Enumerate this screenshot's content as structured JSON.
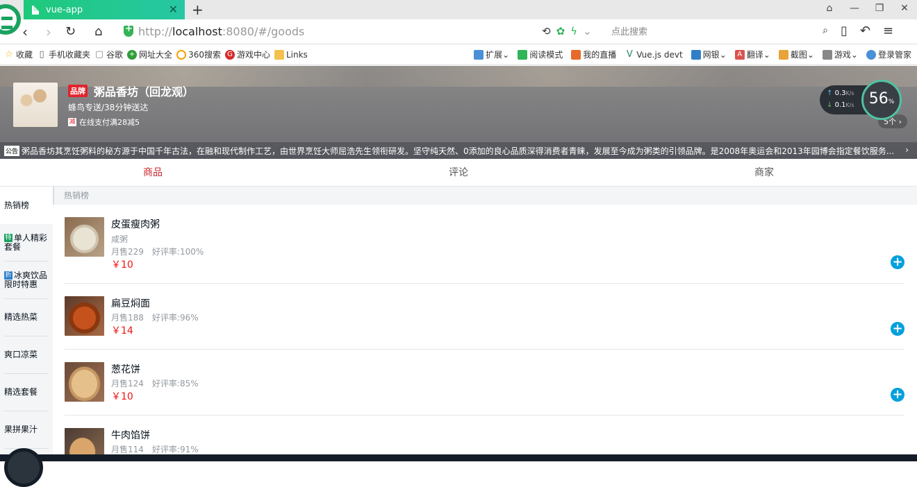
{
  "browser": {
    "tab_title": "vue-app",
    "url_scheme": "http://",
    "url_host": "localhost",
    "url_rest": ":8080/#/goods",
    "search_placeholder": "点此搜索",
    "bookmarks": [
      {
        "label": "收藏",
        "icon": "star-icon",
        "color": "#f5b400"
      },
      {
        "label": "手机收藏夹",
        "icon": "phone-icon",
        "color": "#666666"
      },
      {
        "label": "谷歌",
        "icon": "doc-icon",
        "color": "#888888"
      },
      {
        "label": "网址大全",
        "icon": "globe-icon",
        "color": "#2f9e3a"
      },
      {
        "label": "360搜索",
        "icon": "360-icon",
        "color": "#f5a300"
      },
      {
        "label": "游戏中心",
        "icon": "game-icon",
        "color": "#d62b2b"
      },
      {
        "label": "Links",
        "icon": "folder-icon",
        "color": "#f2c14e"
      }
    ],
    "bookmarks_right": [
      {
        "label": "扩展",
        "icon": "grid-icon"
      },
      {
        "label": "阅读模式",
        "icon": "book-icon"
      },
      {
        "label": "我的直播",
        "icon": "tv-icon"
      },
      {
        "label": "Vue.js devt",
        "icon": "vue-icon"
      },
      {
        "label": "网银",
        "icon": "shield-icon"
      },
      {
        "label": "翻译",
        "icon": "translate-icon"
      },
      {
        "label": "截图",
        "icon": "scissors-icon"
      },
      {
        "label": "游戏",
        "icon": "gamepad-icon"
      },
      {
        "label": "登录管家",
        "icon": "key-icon"
      }
    ],
    "speed": {
      "up": "0.3",
      "down": "0.1",
      "unit": "K/s",
      "percent": "56",
      "percent_unit": "%"
    }
  },
  "seller": {
    "brand_label": "品牌",
    "name": "粥品香坊（回龙观）",
    "delivery": "蜂鸟专送/38分钟送达",
    "discount_icon": "减",
    "discount": "在线支付满28减5",
    "support_count": "5个",
    "bulletin_tag": "公告",
    "bulletin": "粥品香坊其烹饪粥料的秘方源于中国千年古法，在融和现代制作工艺，由世界烹饪大师屈浩先生领衔研发。坚守纯天然、0添加的良心品质深得消费者青睐，发展至今成为粥类的引领品牌。是2008年奥运会和2013年园博会指定餐饮服务..."
  },
  "tabs": {
    "goods": "商品",
    "ratings": "评论",
    "seller": "商家"
  },
  "menu": [
    {
      "label": "热销榜",
      "tag": ""
    },
    {
      "label": "单人精彩套餐",
      "tag": "特",
      "tag_color": "green"
    },
    {
      "label": "冰爽饮品限时特惠",
      "tag": "折",
      "tag_color": "blue"
    },
    {
      "label": "精选热菜",
      "tag": ""
    },
    {
      "label": "爽口凉菜",
      "tag": ""
    },
    {
      "label": "精选套餐",
      "tag": ""
    },
    {
      "label": "果拼果汁",
      "tag": ""
    }
  ],
  "group_title": "热销榜",
  "foods": [
    {
      "name": "皮蛋瘦肉粥",
      "desc": "咸粥",
      "sell": "月售229",
      "rating": "好评率:100%",
      "price": "￥10"
    },
    {
      "name": "扁豆焖面",
      "desc": "",
      "sell": "月售188",
      "rating": "好评率:96%",
      "price": "￥14"
    },
    {
      "name": "葱花饼",
      "desc": "",
      "sell": "月售124",
      "rating": "好评率:85%",
      "price": "￥10"
    },
    {
      "name": "牛肉馅饼",
      "desc": "",
      "sell": "月售114",
      "rating": "好评率:91%",
      "price": ""
    }
  ],
  "colors": {
    "accent_red": "#c9282d",
    "price_red": "#f01414",
    "add_blue": "#00a0dc",
    "tab_green": "#1ec97a"
  }
}
